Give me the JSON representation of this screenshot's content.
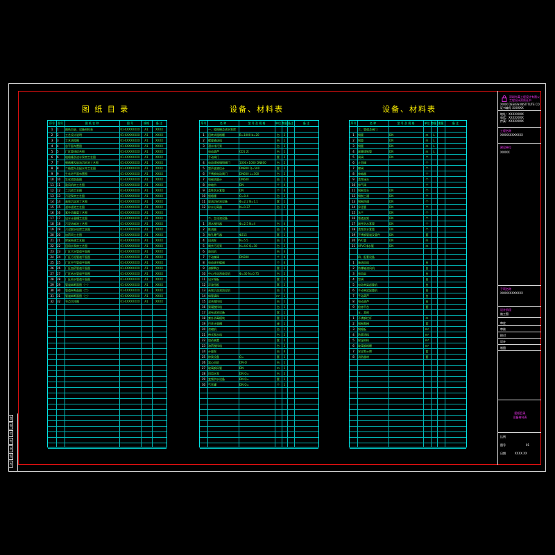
{
  "sheet": {
    "drawing_list_title": "图 纸 目 录",
    "materials_title_1": "设备、材料表",
    "materials_title_2": "设备、材料表"
  },
  "drawing_list": {
    "headers": [
      "序号",
      "图号",
      "图 纸 名 称",
      "图 号",
      "规格",
      "备 注"
    ],
    "rows": [
      [
        "1",
        "1",
        "图纸目录、设备材料表",
        "01-XXXXXXXX",
        "A1",
        "XXXX"
      ],
      [
        "2",
        "2",
        "工艺设计说明",
        "01-XXXXXXXX",
        "A1",
        "XXXX"
      ],
      [
        "3",
        "3",
        "工艺流程图",
        "01-XXXXXXXX",
        "A1",
        "XXXX"
      ],
      [
        "4",
        "4",
        "总平面布置图",
        "01-XXXXXXXX",
        "A1",
        "XXXX"
      ],
      [
        "5",
        "5",
        "厂区管线综合图",
        "01-XXXXXXXX",
        "A1",
        "XXXX"
      ],
      [
        "6",
        "6",
        "粗格栅及进水泵房工艺图",
        "01-XXXXXXXX",
        "A1",
        "XXXX"
      ],
      [
        "7",
        "7",
        "细格栅及旋流沉砂池工艺图",
        "01-XXXXXXXX",
        "A1",
        "XXXX"
      ],
      [
        "8",
        "8",
        "二级提升及配水井工艺图",
        "01-XXXXXXXX",
        "A1",
        "XXXX"
      ],
      [
        "9",
        "9",
        "生化池平面布置图",
        "01-XXXXXXXX",
        "A1",
        "XXXX"
      ],
      [
        "10",
        "10",
        "生化池剖面图",
        "01-XXXXXXXX",
        "A1",
        "XXXX"
      ],
      [
        "11",
        "11",
        "鼓风机房工艺图",
        "01-XXXXXXXX",
        "A1",
        "XXXX"
      ],
      [
        "12",
        "12",
        "二沉池工艺图",
        "01-XXXXXXXX",
        "A1",
        "XXXX"
      ],
      [
        "13",
        "13",
        "污泥泵房工艺图",
        "01-XXXXXXXX",
        "A1",
        "XXXX"
      ],
      [
        "14",
        "14",
        "高效沉淀池工艺图",
        "01-XXXXXXXX",
        "A1",
        "XXXX"
      ],
      [
        "15",
        "15",
        "滤布滤池工艺图",
        "01-XXXXXXXX",
        "A1",
        "XXXX"
      ],
      [
        "16",
        "16",
        "紫外消毒渠工艺图",
        "01-XXXXXXXX",
        "A1",
        "XXXX"
      ],
      [
        "17",
        "17",
        "出水计量槽工艺图",
        "01-XXXXXXXX",
        "A1",
        "XXXX"
      ],
      [
        "18",
        "18",
        "污泥浓缩池工艺图",
        "01-XXXXXXXX",
        "A1",
        "XXXX"
      ],
      [
        "19",
        "19",
        "污泥脱水机房工艺图",
        "01-XXXXXXXX",
        "A1",
        "XXXX"
      ],
      [
        "20",
        "20",
        "加药间工艺图",
        "01-XXXXXXXX",
        "A1",
        "XXXX"
      ],
      [
        "21",
        "21",
        "除臭系统工艺图",
        "01-XXXXXXXX",
        "A1",
        "XXXX"
      ],
      [
        "22",
        "22",
        "回用水泵房工艺图",
        "01-XXXXXXXX",
        "A1",
        "XXXX"
      ],
      [
        "23",
        "23",
        "厂区污水管道平面图",
        "01-XXXXXXXX",
        "A1",
        "XXXX"
      ],
      [
        "24",
        "24",
        "厂区污泥管道平面图",
        "01-XXXXXXXX",
        "A1",
        "XXXX"
      ],
      [
        "25",
        "25",
        "厂区空气管道平面图",
        "01-XXXXXXXX",
        "A1",
        "XXXX"
      ],
      [
        "26",
        "26",
        "厂区加药管道平面图",
        "01-XXXXXXXX",
        "A1",
        "XXXX"
      ],
      [
        "27",
        "27",
        "厂区给水管道平面图",
        "01-XXXXXXXX",
        "A1",
        "XXXX"
      ],
      [
        "28",
        "28",
        "厂区雨水管道平面图",
        "01-XXXXXXXX",
        "A1",
        "XXXX"
      ],
      [
        "29",
        "29",
        "管道纵断面图（一）",
        "01-XXXXXXXX",
        "A1",
        "XXXX"
      ],
      [
        "30",
        "30",
        "管道纵断面图（二）",
        "01-XXXXXXXX",
        "A1",
        "XXXX"
      ],
      [
        "31",
        "31",
        "管道纵断面图（三）",
        "01-XXXXXXXX",
        "A1",
        "XXXX"
      ],
      [
        "32",
        "32",
        "节点大样图",
        "01-XXXXXXXX",
        "A1",
        "XXXX"
      ]
    ],
    "total_rows": 58
  },
  "materials_1": {
    "headers": [
      "序号",
      "名 称",
      "型 号 及 规 格",
      "单位",
      "数量",
      "备注",
      "备 注"
    ],
    "rows": [
      [
        "",
        "一、粗格栅及进水泵房",
        "",
        "",
        "",
        "",
        ""
      ],
      [
        "1",
        "回转式粗格栅",
        "B=1000 b=20",
        "台",
        "2",
        "",
        ""
      ],
      [
        "2",
        "螺旋输送机",
        "",
        "台",
        "1",
        "",
        ""
      ],
      [
        "3",
        "潜水排污泵",
        "",
        "台",
        "3",
        "",
        ""
      ],
      [
        "",
        "电动葫芦",
        "CD1 2t",
        "台",
        "1",
        "",
        ""
      ],
      [
        "",
        "手动闸门",
        "",
        "套",
        "2",
        "",
        ""
      ],
      [
        "4",
        "电动铸铁镶铜闸门",
        "1000×1000 DN800",
        "台",
        "2",
        "",
        ""
      ],
      [
        "5",
        "超声波液位计",
        "DN800 Q=500",
        "套",
        "2",
        "",
        ""
      ],
      [
        "6",
        "不锈钢电动闸门",
        "DN600 L=300",
        "台",
        "2",
        "",
        ""
      ],
      [
        "7",
        "电磁流量计",
        "DN600",
        "台",
        "1",
        "",
        ""
      ],
      [
        "8",
        "伸缩节",
        "DN",
        "个",
        "4",
        "",
        ""
      ],
      [
        "9",
        "柔性防水套管",
        "DN",
        "个",
        "4",
        "",
        ""
      ],
      [
        "10",
        "细格栅",
        "Q=0.4",
        "台",
        "2",
        "",
        ""
      ],
      [
        "11",
        "旋流沉砂池设备",
        "Φ=2.2 N=1.1",
        "套",
        "1",
        "",
        ""
      ],
      [
        "12",
        "砂水分离器",
        "N=0.37",
        "台",
        "1",
        "",
        ""
      ],
      [
        "",
        "",
        "",
        "",
        "",
        "",
        ""
      ],
      [
        "",
        "二、生化池设备",
        "",
        "",
        "",
        "",
        ""
      ],
      [
        "1",
        "潜水搅拌器",
        "Φ=2.5 N=4",
        "台",
        "4",
        "",
        ""
      ],
      [
        "2",
        "推流器",
        "",
        "台",
        "4",
        "",
        ""
      ],
      [
        "3",
        "微孔曝气器",
        "Φ215",
        "套",
        "1",
        "",
        ""
      ],
      [
        "4",
        "回流泵",
        "N=5.5",
        "台",
        "2",
        "",
        ""
      ],
      [
        "5",
        "剩余污泥泵",
        "N=4.0 Q=30",
        "台",
        "2",
        "",
        ""
      ],
      [
        "6",
        "鼓风机",
        "",
        "台",
        "3",
        "",
        ""
      ],
      [
        "7",
        "手动蝶阀",
        "DN300",
        "个",
        "4",
        "",
        ""
      ],
      [
        "8",
        "电动调节蝶阀",
        "",
        "个",
        "4",
        "",
        ""
      ],
      [
        "9",
        "溶解氧仪",
        "",
        "套",
        "2",
        "",
        ""
      ],
      [
        "10",
        "中心传动刮吸泥机",
        "Φ=30 N=0.75",
        "台",
        "2",
        "",
        ""
      ],
      [
        "11",
        "出水堰板",
        "",
        "套",
        "2",
        "",
        ""
      ],
      [
        "12",
        "浮渣挡板",
        "",
        "套",
        "2",
        "",
        ""
      ],
      [
        "13",
        "高效沉淀池刮泥机",
        "",
        "台",
        "1",
        "",
        ""
      ],
      [
        "14",
        "斜管填料",
        "",
        "m²",
        "1",
        "",
        ""
      ],
      [
        "15",
        "混合搅拌机",
        "",
        "台",
        "1",
        "",
        ""
      ],
      [
        "16",
        "絮凝搅拌机",
        "",
        "台",
        "1",
        "",
        ""
      ],
      [
        "17",
        "滤布滤池设备",
        "",
        "套",
        "1",
        "",
        ""
      ],
      [
        "18",
        "紫外消毒模块",
        "",
        "套",
        "1",
        "",
        ""
      ],
      [
        "19",
        "巴氏计量槽",
        "",
        "座",
        "1",
        "",
        ""
      ],
      [
        "20",
        "浓缩机",
        "",
        "台",
        "1",
        "",
        ""
      ],
      [
        "21",
        "带式脱水机",
        "",
        "台",
        "2",
        "",
        ""
      ],
      [
        "22",
        "加药装置",
        "",
        "套",
        "2",
        "",
        ""
      ],
      [
        "23",
        "溶药搅拌机",
        "",
        "台",
        "2",
        "",
        ""
      ],
      [
        "24",
        "计量泵",
        "",
        "台",
        "4",
        "",
        ""
      ],
      [
        "25",
        "除臭设备",
        "Q=",
        "套",
        "1",
        "",
        ""
      ],
      [
        "26",
        "离心风机",
        "DN-Q",
        "台",
        "1",
        "",
        ""
      ],
      [
        "27",
        "玻璃钢风管",
        "DN",
        "m",
        "1",
        "",
        ""
      ],
      [
        "28",
        "回用水泵",
        "DN Q=",
        "台",
        "2",
        "",
        ""
      ],
      [
        "29",
        "变频供水设备",
        "DN Q=",
        "套",
        "1",
        "",
        ""
      ],
      [
        "30",
        "气压罐",
        "DN Q=",
        "个",
        "1",
        "",
        ""
      ]
    ],
    "total_rows": 58
  },
  "materials_2": {
    "headers": [
      "序号",
      "名 称",
      "型 号 及 规 格",
      "单位",
      "数量",
      "重量",
      "备 注"
    ],
    "rows": [
      [
        "",
        "三、管道及阀门",
        "",
        "",
        "",
        "",
        ""
      ],
      [
        "1",
        "钢管",
        "DN",
        "m",
        "L",
        "",
        ""
      ],
      [
        "2",
        "钢管",
        "DN",
        "m",
        "L",
        "",
        ""
      ],
      [
        "3",
        "钢管",
        "DN",
        "m",
        "L",
        "",
        ""
      ],
      [
        "4",
        "球墨铸铁管",
        "DN",
        "m",
        "L",
        "",
        ""
      ],
      [
        "5",
        "闸阀",
        "DN",
        "个",
        "",
        "",
        ""
      ],
      [
        "6",
        "止回阀",
        "",
        "个",
        "",
        "",
        ""
      ],
      [
        "7",
        "蝶阀",
        "",
        "个",
        "",
        "",
        ""
      ],
      [
        "8",
        "伸缩器",
        "",
        "个",
        "",
        "",
        ""
      ],
      [
        "9",
        "柔性接头",
        "",
        "个",
        "",
        "",
        ""
      ],
      [
        "10",
        "排气阀",
        "",
        "个",
        "",
        "",
        ""
      ],
      [
        "11",
        "钢制弯头",
        "DN",
        "个",
        "",
        "",
        ""
      ],
      [
        "12",
        "钢制三通",
        "DN",
        "个",
        "",
        "",
        ""
      ],
      [
        "13",
        "钢制四通",
        "DN",
        "个",
        "",
        "",
        ""
      ],
      [
        "14",
        "异径管",
        "DN",
        "个",
        "",
        "",
        ""
      ],
      [
        "15",
        "法兰",
        "DN",
        "个",
        "",
        "",
        ""
      ],
      [
        "16",
        "管道支架",
        "DN",
        "个",
        "",
        "",
        ""
      ],
      [
        "17",
        "刚性防水套管",
        "DN",
        "个",
        "",
        "",
        ""
      ],
      [
        "18",
        "柔性防水套管",
        "DN",
        "个",
        "",
        "",
        ""
      ],
      [
        "19",
        "不锈钢管道及管件",
        "DN",
        "套",
        "",
        "",
        ""
      ],
      [
        "20",
        "PVC管",
        "DN",
        "m",
        "",
        "",
        ""
      ],
      [
        "21",
        "UPVC排水管",
        "DN",
        "m",
        "",
        "",
        ""
      ],
      [
        "",
        "",
        "",
        "",
        "",
        "",
        ""
      ],
      [
        "",
        "四、配套设备",
        "",
        "",
        "",
        "",
        ""
      ],
      [
        "1",
        "轴流风机",
        "",
        "台",
        "",
        "",
        ""
      ],
      [
        "2",
        "防爆轴流风机",
        "",
        "台",
        "",
        "",
        ""
      ],
      [
        "3",
        "排风扇",
        "",
        "台",
        "",
        "",
        ""
      ],
      [
        "4",
        "空调",
        "",
        "台",
        "",
        "",
        ""
      ],
      [
        "5",
        "电动单梁起重机",
        "",
        "台",
        "",
        "",
        ""
      ],
      [
        "6",
        "手动单梁起重机",
        "",
        "台",
        "",
        "",
        ""
      ],
      [
        "7",
        "手动葫芦",
        "",
        "台",
        "",
        "",
        ""
      ],
      [
        "8",
        "电动葫芦",
        "",
        "台",
        "",
        "",
        ""
      ],
      [
        "9",
        "检修平台",
        "",
        "套",
        "",
        "",
        ""
      ],
      [
        "",
        "五、其他",
        "",
        "",
        "",
        "",
        ""
      ],
      [
        "1",
        "不锈钢栏杆",
        "",
        "m",
        "",
        "",
        ""
      ],
      [
        "2",
        "钢制爬梯",
        "",
        "套",
        "",
        "",
        ""
      ],
      [
        "3",
        "钢格板",
        "",
        "m²",
        "",
        "",
        ""
      ],
      [
        "4",
        "防腐涂料",
        "",
        "m²",
        "",
        "",
        ""
      ],
      [
        "5",
        "保温材料",
        "",
        "m³",
        "",
        "",
        ""
      ],
      [
        "6",
        "玻璃钢格栅",
        "",
        "m²",
        "",
        "",
        ""
      ],
      [
        "7",
        "安全警示牌",
        "",
        "套",
        "",
        "",
        ""
      ],
      [
        "8",
        "消防器材",
        "",
        "套",
        "",
        "",
        ""
      ]
    ],
    "total_rows": 58
  },
  "title_block": {
    "company_line_1": "深圳市某工程设计有限公司",
    "company_line_2": "工程设计资质证书",
    "company_en": "XXXX DESIGN INSTITUTE CO.,LTD.",
    "cert_line": "证书编号 XXXXXX",
    "address_1": "地址：XXXXXXXX",
    "address_2": "电话：XXXXXXXX",
    "address_3": "传真：XXXXXXXX",
    "project_label": "工程名称",
    "project_value": "XXXXXXXXXXXX",
    "client_label": "建设单位",
    "client_value": "XXXXX",
    "item_label": "子项名称",
    "item_value": "XXXXXXXXXXXX",
    "stage_label": "设计阶段",
    "stage_value": "施工图",
    "roles": [
      "审定",
      "审核",
      "校对",
      "设计",
      "制图"
    ],
    "drawing_name_1": "图纸目录",
    "drawing_name_2": "设备材料表",
    "drawing_no_label": "图号",
    "drawing_no_value": "01",
    "date_label": "日期",
    "date_value": "XXXX.XX",
    "scale_label": "比例"
  },
  "left_strip": {
    "labels": [
      "会",
      "签",
      "栏",
      "专",
      "业",
      "签",
      "名"
    ]
  }
}
